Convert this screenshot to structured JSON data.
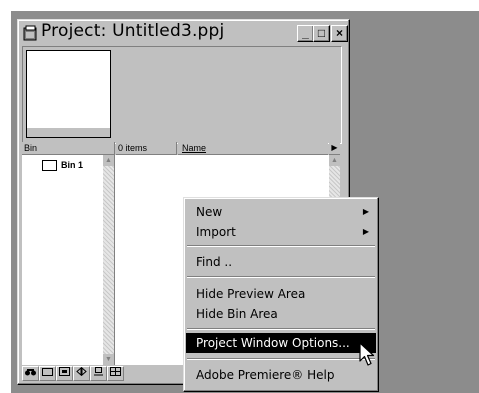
{
  "window": {
    "title": "Project: Untitled3.ppj",
    "controls": {
      "minimize": "_",
      "maximize": "□",
      "close": "×"
    }
  },
  "columns": {
    "bin": "Bin",
    "items_count": "0 items",
    "name": "Name"
  },
  "bins": [
    {
      "label": "Bin 1"
    }
  ],
  "toolbar": {
    "icons": [
      "find-icon",
      "new-bin-icon",
      "storyboard-icon",
      "list-view-icon",
      "icon-view-icon",
      "thumbnail-view-icon"
    ]
  },
  "context_menu": {
    "items": [
      {
        "label": "New",
        "submenu": true
      },
      {
        "label": "Import",
        "submenu": true
      },
      {
        "label": "Find .."
      },
      {
        "label": "Hide Preview Area"
      },
      {
        "label": "Hide Bin Area"
      },
      {
        "label": "Project Window Options...",
        "highlighted": true
      },
      {
        "label": "Adobe Premiere® Help"
      }
    ]
  },
  "colors": {
    "window_face": "#c0c0c0",
    "desktop": "#8c8c8c",
    "highlight": "#000000"
  }
}
